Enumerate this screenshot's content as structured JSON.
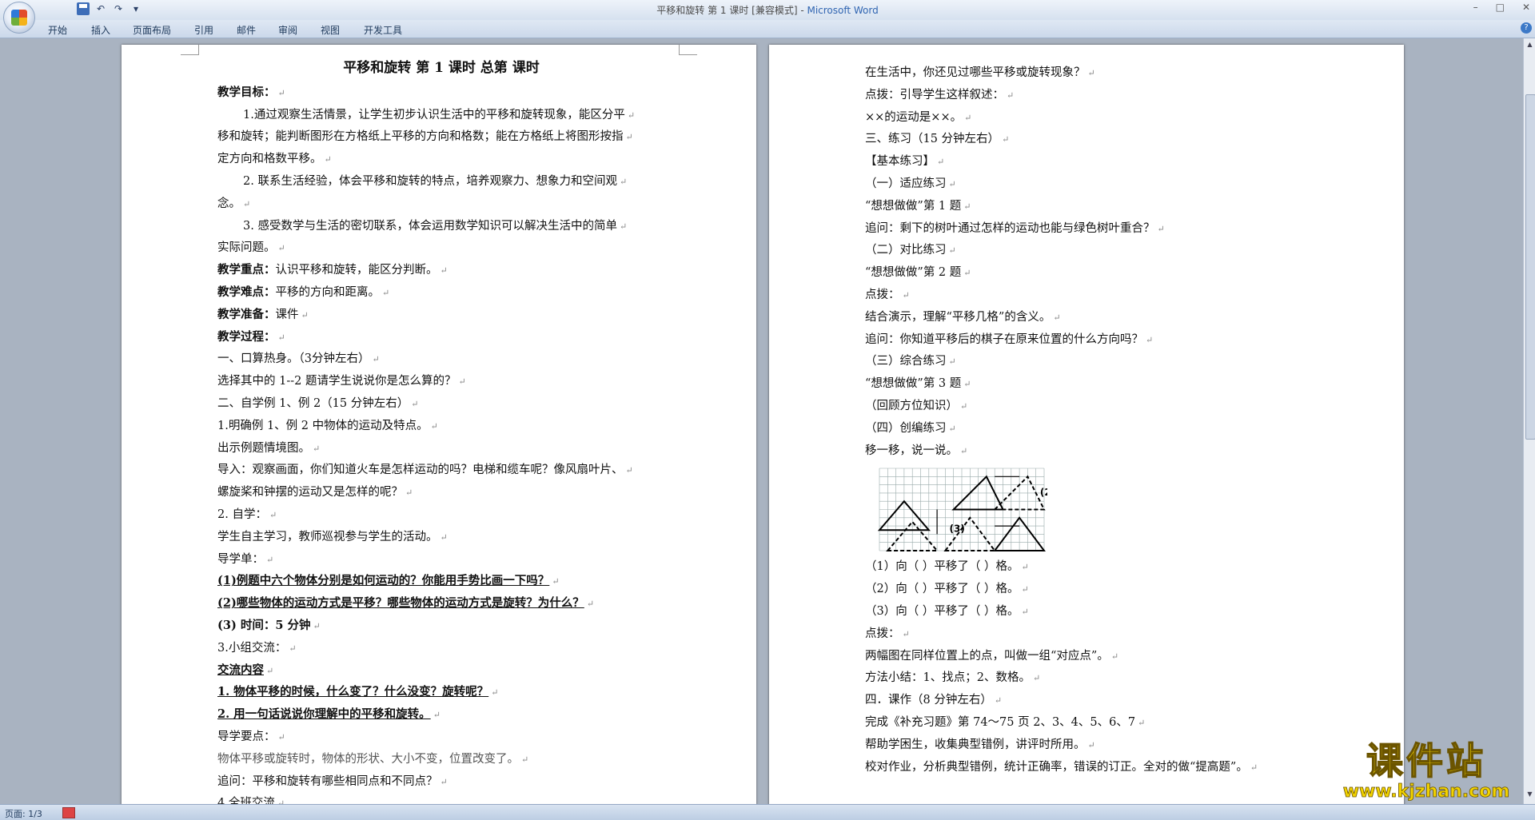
{
  "window": {
    "title": "平移和旋转 第 1 课时 [兼容模式] - ",
    "app_name": "Microsoft Word",
    "controls": [
      "–",
      "□",
      "✕"
    ]
  },
  "ribbon": {
    "tabs": [
      "开始",
      "插入",
      "页面布局",
      "引用",
      "邮件",
      "审阅",
      "视图",
      "开发工具"
    ]
  },
  "icons": {
    "office_button": "office-logo-icon",
    "save": "save-icon",
    "undo": "undo-icon",
    "redo": "redo-icon",
    "help": "help-icon"
  },
  "status": {
    "page_info": "页面: 1/3"
  },
  "watermark": {
    "cn": "课件站",
    "url": "www.kjzhan.com"
  },
  "page1": {
    "title": "平移和旋转    第  1  课时    总第    课时",
    "lines": [
      {
        "t": "教学目标：",
        "s": "b"
      },
      {
        "t": "1.通过观察生活情景，让学生初步认识生活中的平移和旋转现象，能区分平",
        "s": "ind"
      },
      {
        "t": "移和旋转；能判断图形在方格纸上平移的方向和格数；能在方格纸上将图形按指",
        "s": ""
      },
      {
        "t": "定方向和格数平移。",
        "s": ""
      },
      {
        "t": "2. 联系生活经验，体会平移和旋转的特点，培养观察力、想象力和空间观",
        "s": "ind"
      },
      {
        "t": "念。",
        "s": ""
      },
      {
        "t": "3. 感受数学与生活的密切联系，体会运用数学知识可以解决生活中的简单",
        "s": "ind"
      },
      {
        "t": "实际问题。",
        "s": ""
      },
      {
        "t": "教学重点：认识平移和旋转，能区分判断。",
        "s": "bl"
      },
      {
        "t": "教学难点：平移的方向和距离。",
        "s": "bl"
      },
      {
        "t": "教学准备：课件",
        "s": "bl"
      },
      {
        "t": "教学过程：",
        "s": "b"
      },
      {
        "t": "一、口算热身。（3分钟左右）",
        "s": ""
      },
      {
        "t": "选择其中的 1--2 题请学生说说你是怎么算的？",
        "s": ""
      },
      {
        "t": "二、自学例 1、例 2（15 分钟左右）",
        "s": ""
      },
      {
        "t": "1.明确例 1、例 2 中物体的运动及特点。",
        "s": ""
      },
      {
        "t": "出示例题情境图。",
        "s": ""
      },
      {
        "t": "导入：观察画面，你们知道火车是怎样运动的吗？电梯和缆车呢？像风扇叶片、",
        "s": ""
      },
      {
        "t": "螺旋桨和钟摆的运动又是怎样的呢？",
        "s": ""
      },
      {
        "t": "2. 自学：",
        "s": ""
      },
      {
        "t": "学生自主学习，教师巡视参与学生的活动。",
        "s": ""
      },
      {
        "t": "导学单：",
        "s": ""
      },
      {
        "t": "(1)例题中六个物体分别是如何运动的？你能用手势比画一下吗？",
        "s": "bu"
      },
      {
        "t": "(2)哪些物体的运动方式是平移？哪些物体的运动方式是旋转？为什么？",
        "s": "bu"
      },
      {
        "t": "(3) 时间：5 分钟",
        "s": "b"
      },
      {
        "t": "3.小组交流：",
        "s": ""
      },
      {
        "t": "交流内容",
        "s": "bu"
      },
      {
        "t": "1. 物体平移的时候，什么变了？什么没变？旋转呢？",
        "s": "bu"
      },
      {
        "t": "2. 用一句话说说你理解中的平移和旋转。",
        "s": "bu"
      },
      {
        "t": "导学要点：",
        "s": ""
      },
      {
        "t": "物体平移或旋转时，物体的形状、大小不变，位置改变了。",
        "s": "gray"
      },
      {
        "t": "追问：平移和旋转有哪些相同点和不同点？",
        "s": ""
      },
      {
        "t": "4.全班交流",
        "s": ""
      }
    ]
  },
  "page2": {
    "lines_before": [
      "在生活中，你还见过哪些平移或旋转现象？",
      "点拨：引导学生这样叙述：",
      "××的运动是××。",
      "三、练习（15 分钟左右）",
      "【基本练习】",
      "（一）适应练习",
      "“想想做做”第 1 题",
      "追问：剩下的树叶通过怎样的运动也能与绿色树叶重合？",
      "（二）对比练习",
      "“想想做做”第 2 题",
      "点拨：",
      "结合演示，理解“平移几格”的含义。",
      "追问：你知道平移后的棋子在原来位置的什么方向吗？",
      "（三）综合练习",
      "“想想做做”第 3 题",
      "（回顾方位知识）",
      "（四）创编练习",
      "移一移，说一说。"
    ],
    "figure": {
      "labels": [
        "(1)",
        "(2)",
        "(3)"
      ]
    },
    "lines_after": [
      "（1）向（    ）平移了（    ）格。",
      "（2）向（    ）平移了（    ）格。",
      "（3）向（    ）平移了（    ）格。",
      "点拨：",
      "两幅图在同样位置上的点，叫做一组“对应点”。",
      "方法小结：1、找点；2、数格。",
      "四．课作（8 分钟左右）",
      "完成《补充习题》第 74～75 页 2、3、4、5、6、7",
      "帮助学困生，收集典型错例，讲评时所用。",
      "校对作业，分析典型错例，统计正确率，错误的订正。全对的做“提高题”。"
    ]
  }
}
